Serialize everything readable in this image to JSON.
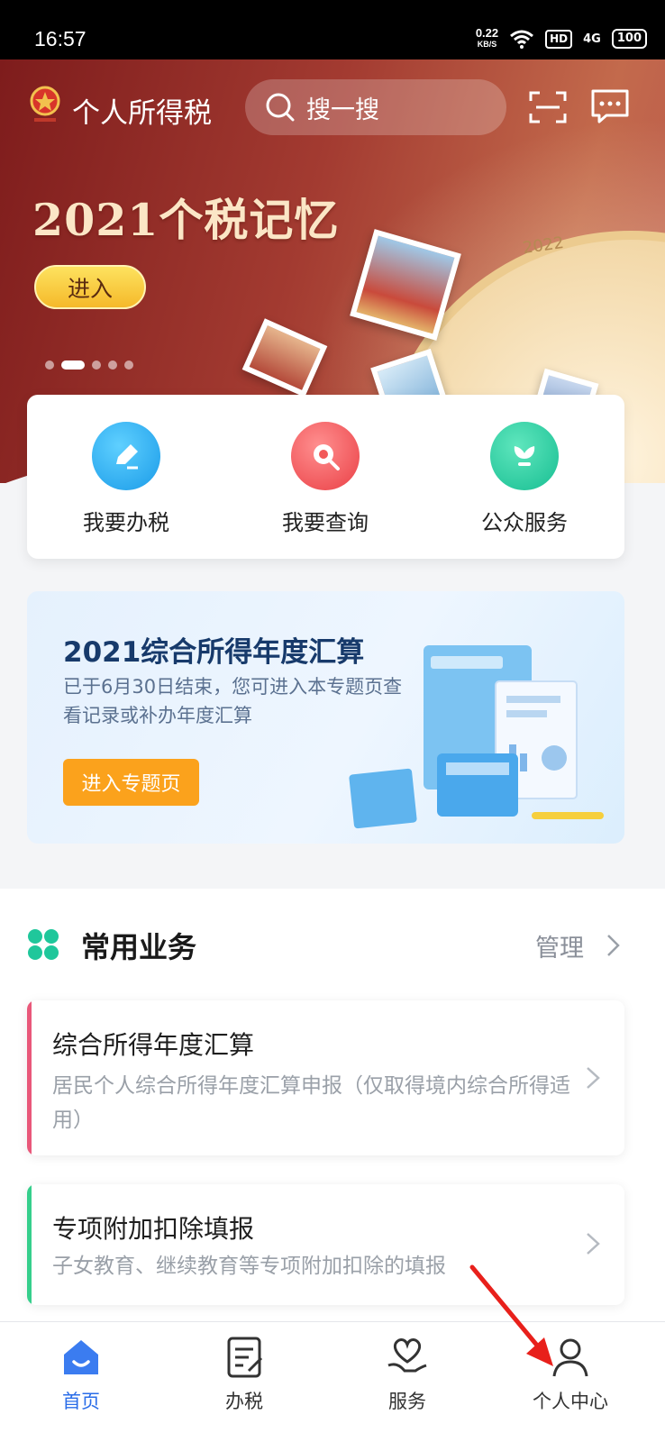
{
  "status_bar": {
    "time": "16:57",
    "net_speed": "0.22",
    "net_unit": "KB/S",
    "hd": "HD",
    "signal": "4G",
    "battery": "100"
  },
  "header": {
    "app_title": "个人所得税",
    "search_placeholder": "搜一搜",
    "icons": [
      "tax-emblem-icon",
      "search-icon",
      "scan-icon",
      "message-icon"
    ]
  },
  "banner": {
    "title": "2021个税记忆",
    "enter_label": "进入",
    "clock_year": "2022",
    "slide_count": 5,
    "active_slide": 1
  },
  "quick_actions": [
    {
      "label": "我要办税",
      "icon": "pen-icon",
      "color": "#1aa3ef"
    },
    {
      "label": "我要查询",
      "icon": "magnifier-icon",
      "color": "#f04a4a"
    },
    {
      "label": "公众服务",
      "icon": "flower-icon",
      "color": "#1fc79b"
    }
  ],
  "promo": {
    "title": "2021综合所得年度汇算",
    "desc": "已于6月30日结束，您可进入本专题页查看记录或补办年度汇算",
    "button_label": "进入专题页"
  },
  "common_services": {
    "title": "常用业务",
    "manage_label": "管理",
    "items": [
      {
        "title": "综合所得年度汇算",
        "desc": "居民个人综合所得年度汇算申报（仅取得境内综合所得适用）",
        "accent": "#e9587a"
      },
      {
        "title": "专项附加扣除填报",
        "desc": "子女教育、继续教育等专项附加扣除的填报",
        "accent": "#36cf8c"
      }
    ]
  },
  "tab_bar": {
    "tabs": [
      {
        "label": "首页",
        "icon": "home-icon",
        "active": true
      },
      {
        "label": "办税",
        "icon": "tax-form-icon",
        "active": false
      },
      {
        "label": "服务",
        "icon": "heart-hand-icon",
        "active": false
      },
      {
        "label": "个人中心",
        "icon": "person-icon",
        "active": false
      }
    ],
    "active_color": "#2a6de8"
  }
}
